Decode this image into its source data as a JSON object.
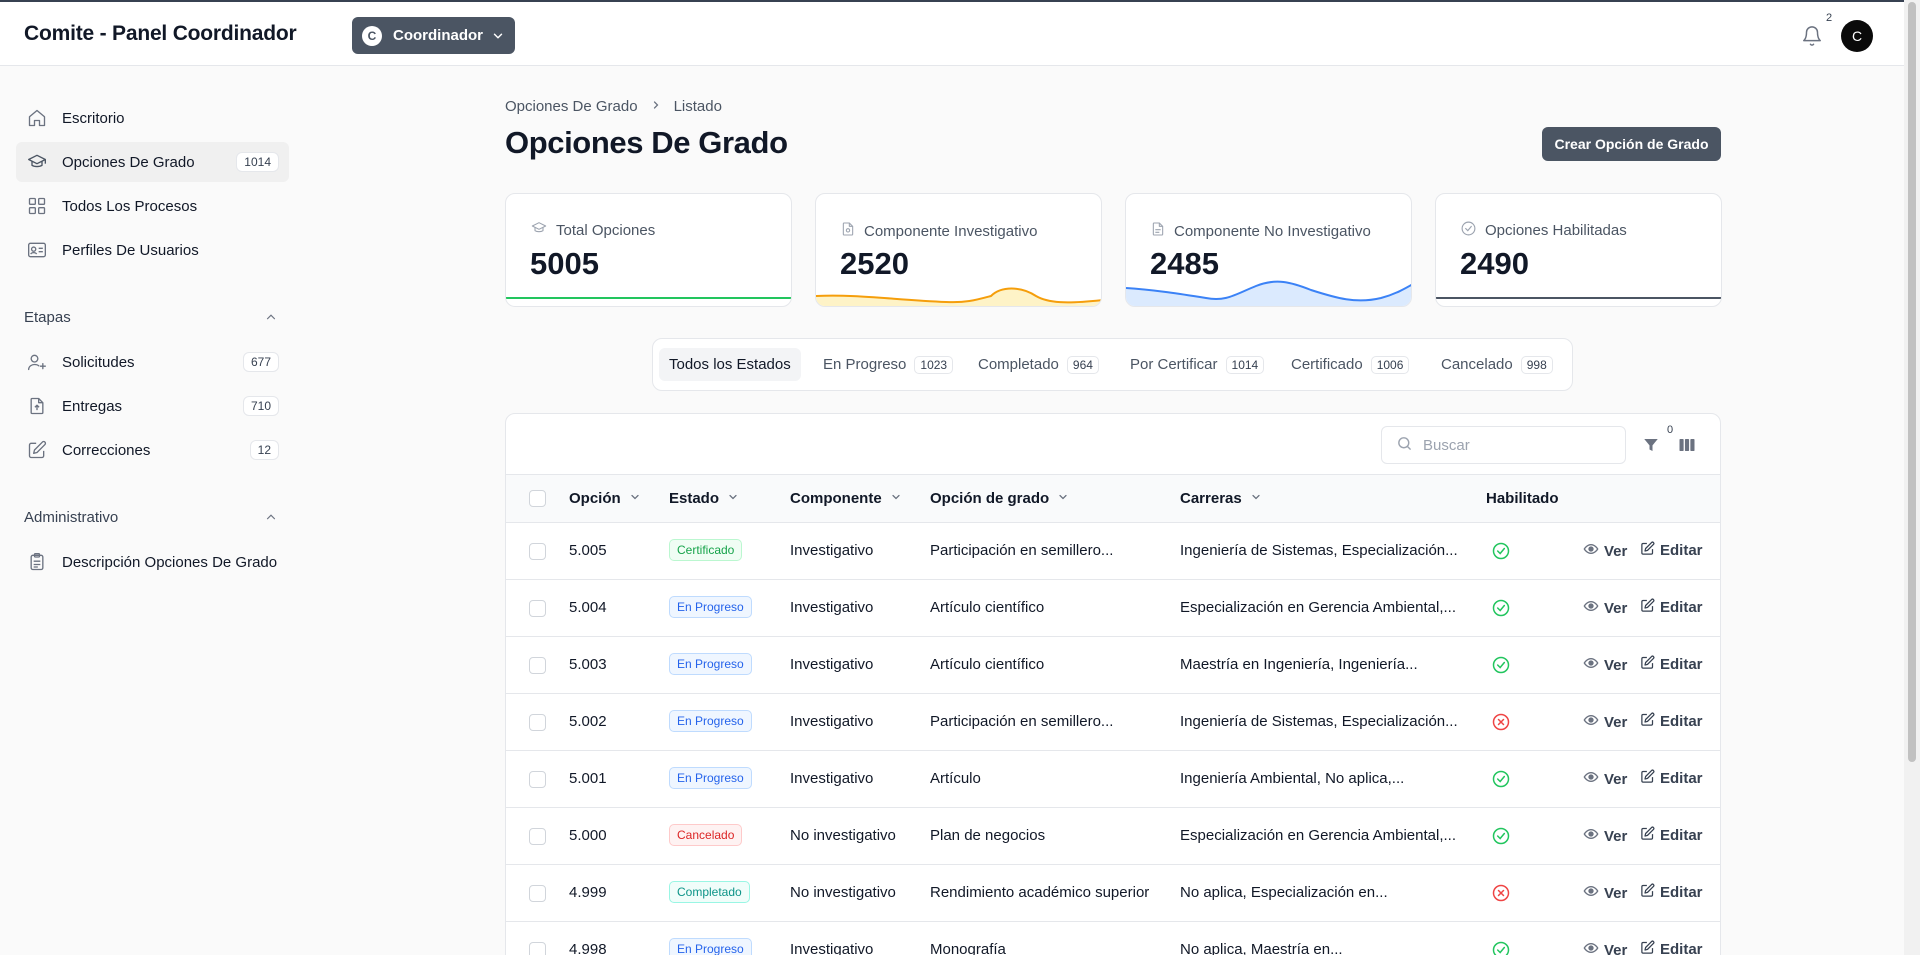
{
  "header": {
    "app_title": "Comite - Panel Coordinador",
    "role_initial": "C",
    "role_label": "Coordinador",
    "notifications_count": "2",
    "user_initial": "C"
  },
  "sidebar": {
    "items": [
      {
        "label": "Escritorio",
        "icon": "home-icon"
      },
      {
        "label": "Opciones De Grado",
        "badge": "1014",
        "icon": "graduation-cap-icon"
      },
      {
        "label": "Todos Los Procesos",
        "icon": "grid-icon"
      },
      {
        "label": "Perfiles De Usuarios",
        "icon": "id-card-icon"
      }
    ],
    "etapas_label": "Etapas",
    "etapas": [
      {
        "label": "Solicitudes",
        "badge": "677",
        "icon": "user-plus-icon"
      },
      {
        "label": "Entregas",
        "badge": "710",
        "icon": "file-upload-icon"
      },
      {
        "label": "Correcciones",
        "badge": "12",
        "icon": "pencil-square-icon"
      }
    ],
    "admin_label": "Administrativo",
    "admin": [
      {
        "label": "Descripción Opciones De Grado",
        "icon": "clipboard-list-icon"
      }
    ]
  },
  "breadcrumb": {
    "parent": "Opciones De Grado",
    "current": "Listado"
  },
  "page": {
    "title": "Opciones De Grado",
    "create_button": "Crear Opción de Grado"
  },
  "stats": [
    {
      "label": "Total Opciones",
      "value": "5005",
      "color": "#22c55e"
    },
    {
      "label": "Componente Investigativo",
      "value": "2520",
      "color": "#f59e0b"
    },
    {
      "label": "Componente No Investigativo",
      "value": "2485",
      "color": "#3b82f6"
    },
    {
      "label": "Opciones Habilitadas",
      "value": "2490",
      "color": "#4b5563"
    }
  ],
  "filter_tabs": [
    {
      "label": "Todos los Estados",
      "count": ""
    },
    {
      "label": "En Progreso",
      "count": "1023"
    },
    {
      "label": "Completado",
      "count": "964"
    },
    {
      "label": "Por Certificar",
      "count": "1014"
    },
    {
      "label": "Certificado",
      "count": "1006"
    },
    {
      "label": "Cancelado",
      "count": "998"
    }
  ],
  "table": {
    "search_placeholder": "Buscar",
    "filter_count": "0",
    "columns": [
      "Opción",
      "Estado",
      "Componente",
      "Opción de grado",
      "Carreras",
      "Habilitado"
    ],
    "view_label": "Ver",
    "edit_label": "Editar",
    "rows": [
      {
        "id": "5.005",
        "estado": "Certificado",
        "componente": "Investigativo",
        "opcion": "Participación en semillero...",
        "carreras": "Ingeniería de Sistemas, Especialización...",
        "habilitado": true
      },
      {
        "id": "5.004",
        "estado": "En Progreso",
        "componente": "Investigativo",
        "opcion": "Artículo científico",
        "carreras": "Especialización en Gerencia Ambiental,...",
        "habilitado": true
      },
      {
        "id": "5.003",
        "estado": "En Progreso",
        "componente": "Investigativo",
        "opcion": "Artículo científico",
        "carreras": "Maestría en Ingeniería, Ingeniería...",
        "habilitado": true
      },
      {
        "id": "5.002",
        "estado": "En Progreso",
        "componente": "Investigativo",
        "opcion": "Participación en semillero...",
        "carreras": "Ingeniería de Sistemas, Especialización...",
        "habilitado": false
      },
      {
        "id": "5.001",
        "estado": "En Progreso",
        "componente": "Investigativo",
        "opcion": "Artículo",
        "carreras": "Ingeniería Ambiental, No aplica,...",
        "habilitado": true
      },
      {
        "id": "5.000",
        "estado": "Cancelado",
        "componente": "No investigativo",
        "opcion": "Plan de negocios",
        "carreras": "Especialización en Gerencia Ambiental,...",
        "habilitado": true
      },
      {
        "id": "4.999",
        "estado": "Completado",
        "componente": "No investigativo",
        "opcion": "Rendimiento académico superior",
        "carreras": "No aplica, Especialización en...",
        "habilitado": false
      },
      {
        "id": "4.998",
        "estado": "En Progreso",
        "componente": "Investigativo",
        "opcion": "Monografía",
        "carreras": "No aplica, Maestría en...",
        "habilitado": true
      }
    ]
  }
}
